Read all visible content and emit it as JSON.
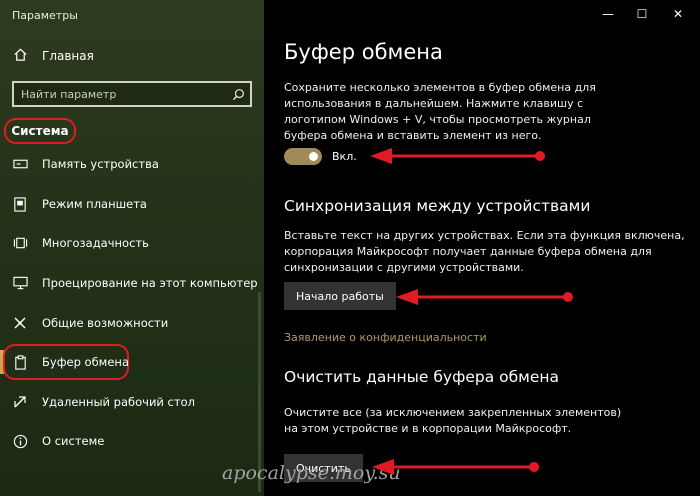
{
  "window": {
    "title": "Параметры",
    "controls": {
      "minimize": "—",
      "maximize": "☐",
      "close": "✕"
    }
  },
  "sidebar": {
    "home_label": "Главная",
    "search_placeholder": "Найти параметр",
    "category_label": "Система",
    "items": [
      {
        "label": "Память устройства",
        "icon": "storage-icon"
      },
      {
        "label": "Режим планшета",
        "icon": "tablet-icon"
      },
      {
        "label": "Многозадачность",
        "icon": "multitasking-icon"
      },
      {
        "label": "Проецирование на этот компьютер",
        "icon": "projecting-icon"
      },
      {
        "label": "Общие возможности",
        "icon": "shared-experiences-icon"
      },
      {
        "label": "Буфер обмена",
        "icon": "clipboard-icon",
        "selected": true
      },
      {
        "label": "Удаленный рабочий стол",
        "icon": "remote-desktop-icon"
      },
      {
        "label": "О системе",
        "icon": "info-icon"
      }
    ]
  },
  "main": {
    "title": "Буфер обмена",
    "intro": "Сохраните несколько элементов в буфер обмена для использования в дальнейшем. Нажмите клавишу с логотипом Windows + V, чтобы просмотреть журнал буфера обмена и вставить элемент из него.",
    "history_toggle": {
      "state": "Вкл.",
      "on": true
    },
    "sync": {
      "heading": "Синхронизация между устройствами",
      "text": "Вставьте текст на других устройствах. Если эта функция включена, корпорация Майкрософт получает данные буфера обмена для синхронизации с другими устройствами.",
      "button": "Начало работы"
    },
    "privacy_link": "Заявление о конфиденциальности",
    "clear": {
      "heading": "Очистить данные буфера обмена",
      "text": "Очистите все (за исключением закрепленных элементов) на этом устройстве и в корпорации Майкрософт.",
      "button": "Очистить"
    }
  },
  "annotations": {
    "color": "#e21b22",
    "watermark": "apocalypse.moy.su"
  }
}
